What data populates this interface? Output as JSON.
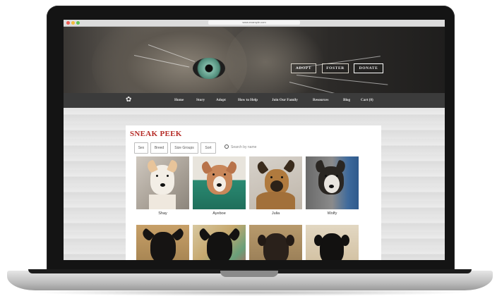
{
  "browser": {
    "url": "www.example.com"
  },
  "hero": {
    "buttons": [
      {
        "label": "ADOPT"
      },
      {
        "label": "FOSTER"
      },
      {
        "label": "DONATE"
      }
    ]
  },
  "nav": {
    "items": [
      {
        "label": "Home"
      },
      {
        "label": "Story"
      },
      {
        "label": "Adopt"
      },
      {
        "label": "How to Help"
      },
      {
        "label": "Join Our Family"
      },
      {
        "label": "Resources"
      },
      {
        "label": "Blog"
      },
      {
        "label": "Cart (0)"
      }
    ]
  },
  "main": {
    "title": "SNEAK PEEK",
    "filters": [
      {
        "label": "Sex"
      },
      {
        "label": "Breed"
      },
      {
        "label": "Size Groups"
      },
      {
        "label": "Sort"
      }
    ],
    "search_placeholder": "Search by name",
    "pets": [
      {
        "name": "Shay"
      },
      {
        "name": "Ayeboe"
      },
      {
        "name": "Julia"
      },
      {
        "name": "Wolfy"
      },
      {
        "name": ""
      },
      {
        "name": ""
      },
      {
        "name": ""
      },
      {
        "name": ""
      }
    ]
  },
  "colors": {
    "accent": "#b52a25",
    "navbar": "#3b3b3b"
  },
  "icons": {
    "logo": "paw-icon",
    "search": "search-icon"
  }
}
